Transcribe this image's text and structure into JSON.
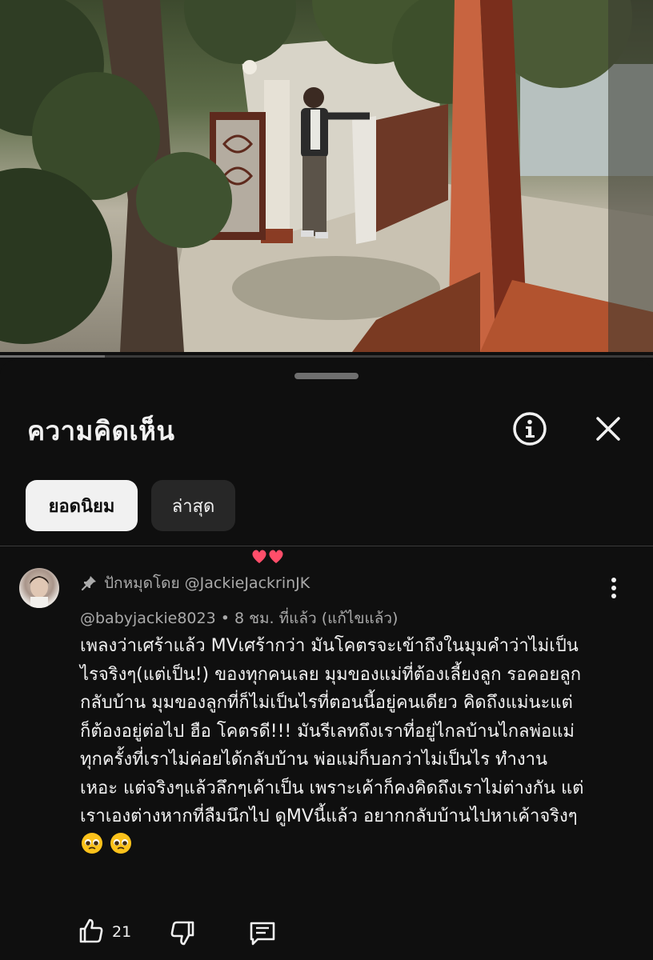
{
  "video": {
    "scene": "video-frame",
    "progress_fraction": 0.16
  },
  "panel": {
    "title": "ความคิดเห็น",
    "info_icon": "info-icon",
    "close_icon": "close-icon"
  },
  "sort_chips": [
    {
      "label": "ยอดนิยม",
      "selected": true
    },
    {
      "label": "ล่าสุด",
      "selected": false
    }
  ],
  "comment": {
    "pinned_label": "ปักหมุดโดย @JackieJackrinJK",
    "meta": "@babyjackie8023 • 8 ชม. ที่แล้ว (แก้ไขแล้ว)",
    "text": "เพลงว่าเศร้าแล้ว MVเศร้ากว่า มันโคตรจะเข้าถึงในมุมคำว่าไม่เป็น\nไรจริงๆ(แต่เป็น!) ของทุกคนเลย มุมของแม่ที่ต้องเลี้ยงลูก รอคอยลูก\nกลับบ้าน มุมของลูกที่ก็ไม่เป็นไรที่ตอนนี้อยู่คนเดียว คิดถึงแม่นะแต่\nก็ต้องอยู่ต่อไป ฮือ โคตรดี!!! มันรีเลทถึงเราที่อยู่ไกลบ้านไกลพ่อแม่\nทุกครั้งที่เราไม่ค่อยได้กลับบ้าน พ่อแม่ก็บอกว่าไม่เป็นไร ทำงาน\nเหอะ แต่จริงๆแล้วลึกๆเค้าเป็น เพราะเค้าก็คงคิดถึงเราไม่ต่างกัน แต่\nเราเองต่างหากที่ลืมนึกไป ดูMVนี้แล้ว อยากกลับบ้านไปหาเค้าจริงๆ",
    "emoji": [
      "pleading-face-emoji",
      "pleading-face-emoji"
    ],
    "hearts": "creator-heart",
    "like_count": "21",
    "colors": {
      "accent_heart": "#ff4e6a",
      "text": "#f1f1f1",
      "secondary": "#aaaaaa"
    }
  }
}
